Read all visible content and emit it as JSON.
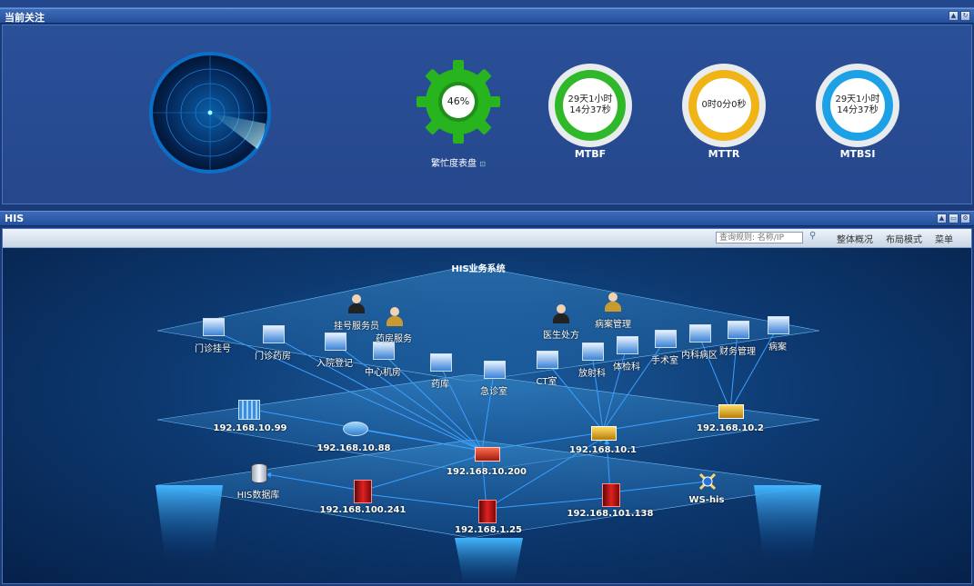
{
  "panel_focus": {
    "title": "当前关注",
    "gauge": {
      "value": "46%",
      "label": "繁忙度表盘"
    },
    "rings": [
      {
        "line1": "29天1小时",
        "line2": "14分37秒",
        "label": "MTBF",
        "color": "#2fb82a"
      },
      {
        "line1": "0时0分0秒",
        "line2": "",
        "label": "MTTR",
        "color": "#f0b417"
      },
      {
        "line1": "29天1小时",
        "line2": "14分37秒",
        "label": "MTBSI",
        "color": "#1da1e6"
      }
    ]
  },
  "panel_his": {
    "title": "HIS",
    "toolbar": {
      "search_placeholder": "查询规则: 名称/IP",
      "items": [
        "整体概况",
        "布局模式",
        "菜单"
      ]
    },
    "system_title": "HIS业务系统",
    "top_nodes": [
      {
        "label": "门诊挂号",
        "type": "pc"
      },
      {
        "label": "门诊药房",
        "type": "pc"
      },
      {
        "label": "入院登记",
        "type": "pc"
      },
      {
        "label": "中心机房",
        "type": "pc"
      },
      {
        "label": "药库",
        "type": "pc"
      },
      {
        "label": "急诊室",
        "type": "pc"
      },
      {
        "label": "CT室",
        "type": "pc"
      },
      {
        "label": "放射科",
        "type": "pc"
      },
      {
        "label": "体检科",
        "type": "pc"
      },
      {
        "label": "手术室",
        "type": "pc"
      },
      {
        "label": "内科病区",
        "type": "pc"
      },
      {
        "label": "财务管理",
        "type": "pc"
      },
      {
        "label": "病案",
        "type": "pc"
      },
      {
        "label": "挂号服务员",
        "type": "person"
      },
      {
        "label": "药房服务",
        "type": "person"
      },
      {
        "label": "医生处方",
        "type": "person"
      },
      {
        "label": "病案管理",
        "type": "person"
      }
    ],
    "mid_nodes": [
      {
        "label": "192.168.10.99",
        "type": "firewall"
      },
      {
        "label": "192.168.10.88",
        "type": "router"
      },
      {
        "label": "192.168.10.200",
        "type": "switch-red"
      },
      {
        "label": "192.168.10.1",
        "type": "switch"
      },
      {
        "label": "192.168.10.2",
        "type": "switch"
      }
    ],
    "bottom_nodes": [
      {
        "label": "HIS数据库",
        "type": "database"
      },
      {
        "label": "192.168.100.241",
        "type": "server"
      },
      {
        "label": "192.168.1.25",
        "type": "server"
      },
      {
        "label": "192.168.101.138",
        "type": "server"
      },
      {
        "label": "WS-his",
        "type": "service"
      }
    ]
  }
}
